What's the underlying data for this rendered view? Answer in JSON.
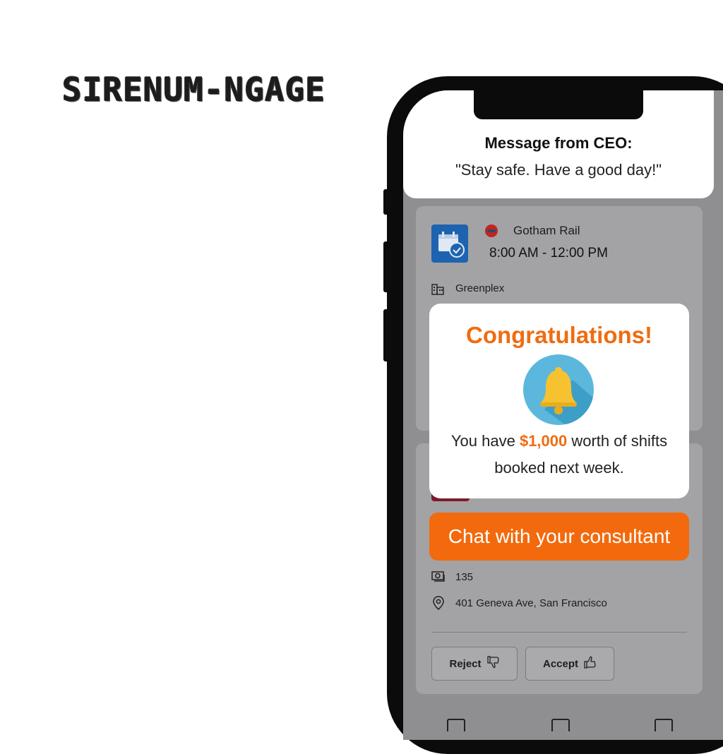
{
  "brand": {
    "logo_text": "SIRENUM-NGAGE"
  },
  "ceo_message": {
    "title": "Message from CEO:",
    "text": "\"Stay safe. Have a good day!\""
  },
  "shift_card": {
    "company": "Gotham Rail",
    "time": "8:00 AM - 12:00 PM",
    "site": "Greenplex",
    "icons": [
      "calendar-check-icon",
      "gotham-rail-logo-icon",
      "building-icon"
    ]
  },
  "popup": {
    "title": "Congratulations!",
    "icon": "bell-icon",
    "text_before": "You have ",
    "amount": "$1,000",
    "text_after": " worth of shifts booked next week."
  },
  "chat_button": {
    "label": "Chat with your consultant"
  },
  "shift_card_2": {
    "pay_value": "135",
    "address": "401 Geneva Ave, San Francisco",
    "icons": [
      "money-icon",
      "location-pin-icon"
    ]
  },
  "actions": {
    "reject_label": "Reject",
    "accept_label": "Accept",
    "icons": [
      "thumbs-down-icon",
      "thumbs-up-icon"
    ]
  },
  "tab_bar": {
    "icons": [
      "calendar-tab-icon",
      "messages-tab-icon",
      "grid-tab-icon"
    ]
  },
  "colors": {
    "accent": "#f26a0d",
    "highlight": "#ef6c11",
    "overlay": "#8f8f91",
    "calendar_blue": "#1e63b0",
    "bell_bg": "#5bb8dc",
    "bell": "#f7c230"
  }
}
